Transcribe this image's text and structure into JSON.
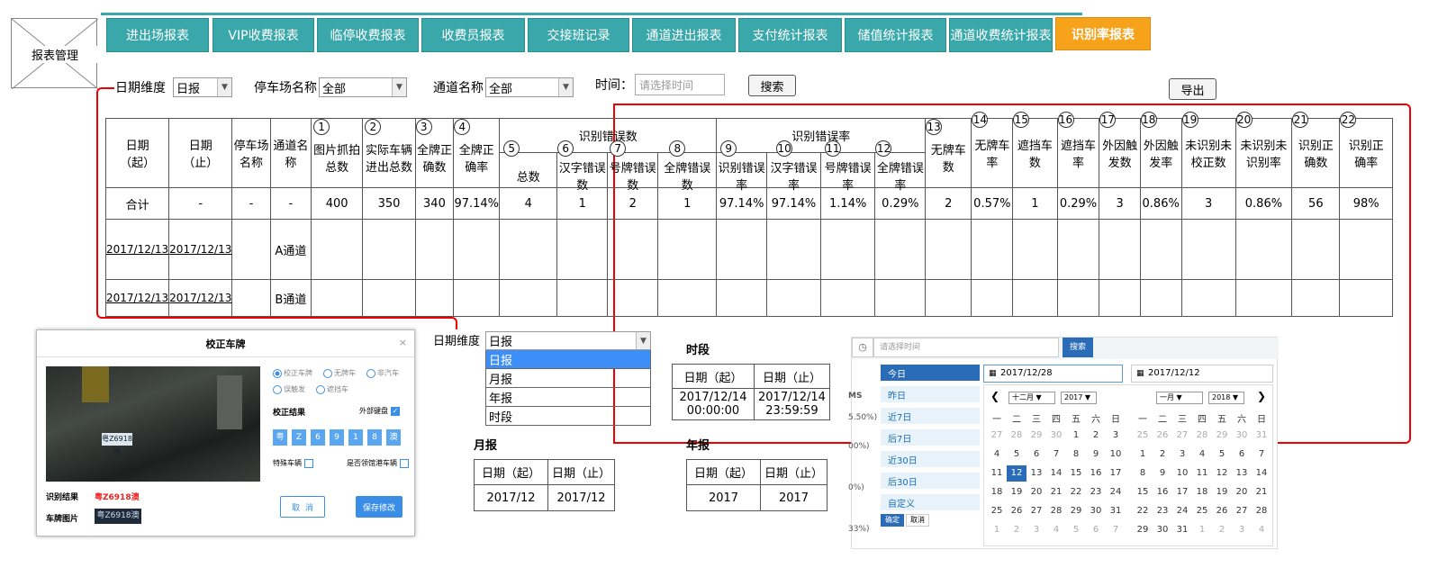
{
  "logo": {
    "label": "报表管理"
  },
  "tabs": [
    {
      "label": "进出场报表"
    },
    {
      "label": "VIP收费报表"
    },
    {
      "label": "临停收费报表"
    },
    {
      "label": "收费员报表"
    },
    {
      "label": "交接班记录"
    },
    {
      "label": "通道进出报表"
    },
    {
      "label": "支付统计报表"
    },
    {
      "label": "储值统计报表"
    },
    {
      "label": "通道收费统计报表"
    },
    {
      "label": "识别率报表"
    }
  ],
  "filters": {
    "date_dim_label": "日期维度",
    "date_dim_value": "日报",
    "park_label": "停车场名称",
    "park_value": "全部",
    "lane_label": "通道名称",
    "lane_value": "全部",
    "time_label": "时间：",
    "time_placeholder": "请选择时间",
    "search": "搜索",
    "export": "导出"
  },
  "table": {
    "h": {
      "ds": "日期\n（起）",
      "de": "日期\n（止）",
      "park": "停车场\n名称",
      "lane": "通道名\n称",
      "c1": "图片抓拍\n总数",
      "c2": "实际车辆\n进出总数",
      "c3": "全牌正\n确数",
      "c4": "全牌正\n确率",
      "g1": "识别错误数",
      "c5": "总数",
      "c6": "汉字错误数",
      "c7": "号牌错误数",
      "c8": "全牌错误数",
      "g2": "识别错误率",
      "c9": "识别错误率",
      "c10": "汉字错误率",
      "c11": "号牌错误率",
      "c12": "全牌错误率",
      "c13": "无牌车\n数",
      "c14": "无牌车\n率",
      "c15": "遮挡车\n数",
      "c16": "遮挡车\n率",
      "c17": "外因触\n发数",
      "c18": "外因触\n发率",
      "c19": "未识别未\n校正数",
      "c20": "未识别未\n识别率",
      "c21": "识别正\n确数",
      "c22": "识别正\n确率"
    },
    "total": [
      "合计",
      "-",
      "-",
      "-",
      "400",
      "350",
      "340",
      "97.14%",
      "4",
      "1",
      "2",
      "1",
      "97.14%",
      "97.14%",
      "1.14%",
      "0.29%",
      "2",
      "0.57%",
      "1",
      "0.29%",
      "3",
      "0.86%",
      "3",
      "0.86%",
      "56",
      "98%"
    ],
    "rows": [
      {
        "ds": "2017/12/13",
        "de": "2017/12/13",
        "lane": "A通道"
      },
      {
        "ds": "2017/12/13",
        "de": "2017/12/13",
        "lane": "B通道"
      }
    ]
  },
  "dialog": {
    "title": "校正车牌",
    "radios": [
      "校正车牌",
      "无牌车",
      "非汽车",
      "误触发",
      "遮挡车"
    ],
    "result_label": "校正结果",
    "ext_kbd": "外部键盘",
    "chars": [
      "粤",
      "Z",
      "6",
      "9",
      "1",
      "8",
      "澳"
    ],
    "special": "特殊车辆",
    "ext_plate": "是否领馆港车辆",
    "rec_label": "识别结果",
    "rec_value": "粤Z6918澳",
    "plate_img_label": "车牌图片",
    "plate_img_text": "粤Z6918澳",
    "cancel": "取  消",
    "save": "保存修改"
  },
  "dropdown": {
    "label": "日期维度",
    "value": "日报",
    "options": [
      "日报",
      "月报",
      "年报",
      "时段"
    ]
  },
  "period": {
    "title": "时段",
    "h1": "日期（起）",
    "h2": "日期（止）",
    "v1": "2017/12/14\n00:00:00",
    "v2": "2017/12/14\n23:59:59"
  },
  "monthly": {
    "title": "月报",
    "h1": "日期（起）",
    "h2": "日期（止）",
    "v1": "2017/12",
    "v2": "2017/12"
  },
  "yearly": {
    "title": "年报",
    "h1": "日期（起）",
    "h2": "日期（止）",
    "v1": "2017",
    "v2": "2017"
  },
  "calendar": {
    "placeholder": "请选择时间",
    "search": "搜索",
    "side_labels": [
      "MS",
      "5.50%)",
      "00%)",
      "0%)",
      "33%)"
    ],
    "quick": [
      "今日",
      "昨日",
      "近7日",
      "后7日",
      "近30日",
      "后30日",
      "自定义"
    ],
    "ok": "确定",
    "cancel": "取消",
    "start": "2017/12/28",
    "end": "2017/12/12",
    "m1": "十二月",
    "y1": "2017",
    "m2": "一月",
    "y2": "2018",
    "weekdays": [
      "一",
      "二",
      "三",
      "四",
      "五",
      "六",
      "日"
    ],
    "left": [
      [
        "27",
        "28",
        "29",
        "30",
        "1",
        "2",
        "3"
      ],
      [
        "4",
        "5",
        "6",
        "7",
        "8",
        "9",
        "10"
      ],
      [
        "11",
        "12",
        "13",
        "14",
        "15",
        "16",
        "17"
      ],
      [
        "18",
        "19",
        "20",
        "21",
        "22",
        "23",
        "24"
      ],
      [
        "25",
        "26",
        "27",
        "28",
        "29",
        "30",
        "31"
      ],
      [
        "1",
        "2",
        "3",
        "4",
        "5",
        "6",
        "7"
      ]
    ],
    "right": [
      [
        "25",
        "26",
        "27",
        "28",
        "29",
        "30",
        "31"
      ],
      [
        "1",
        "2",
        "3",
        "4",
        "5",
        "6",
        "7"
      ],
      [
        "8",
        "9",
        "10",
        "11",
        "12",
        "13",
        "14"
      ],
      [
        "15",
        "16",
        "17",
        "18",
        "19",
        "20",
        "21"
      ],
      [
        "22",
        "23",
        "24",
        "25",
        "26",
        "27",
        "28"
      ],
      [
        "29",
        "30",
        "31",
        "1",
        "2",
        "3",
        "4"
      ]
    ]
  }
}
